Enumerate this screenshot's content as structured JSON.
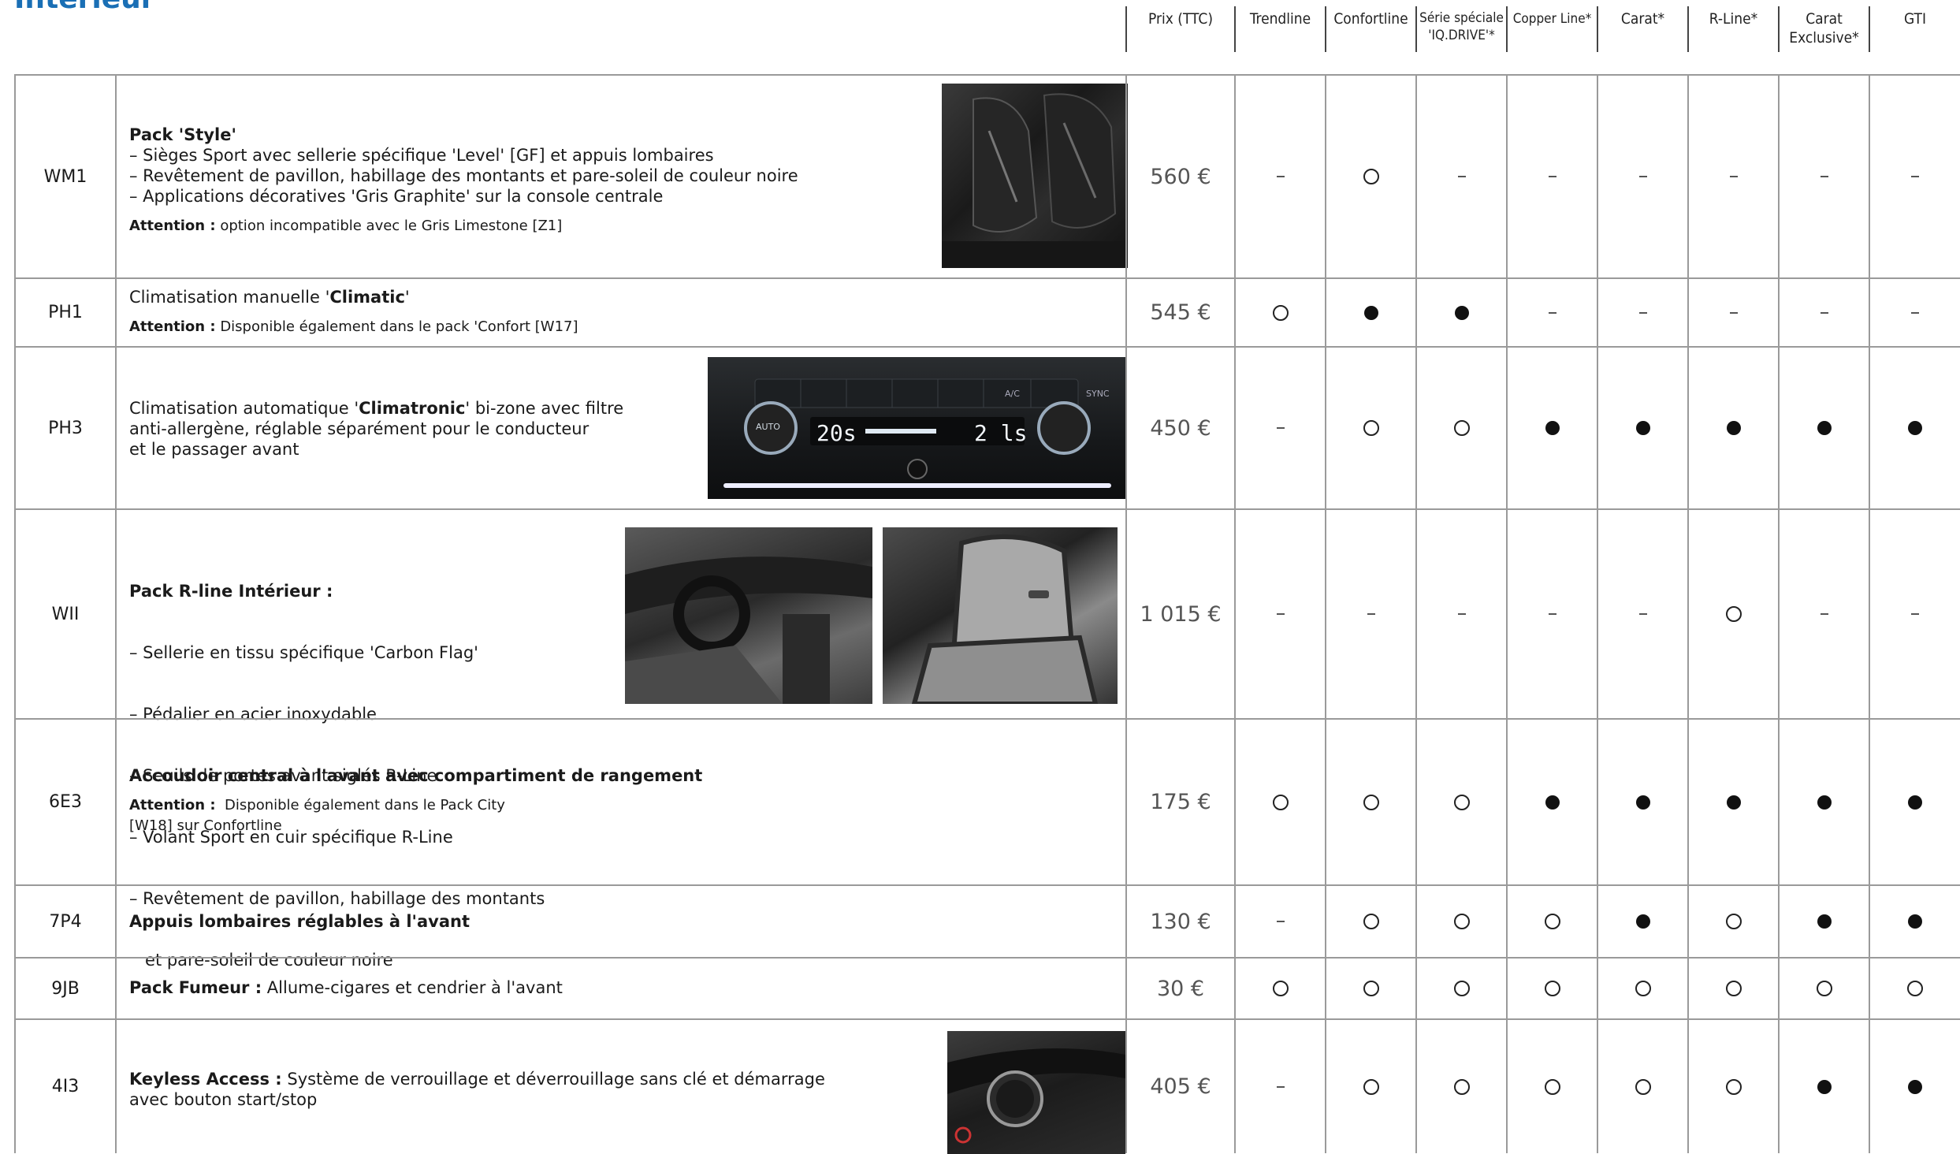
{
  "title": "Intérieur",
  "columns": [
    "Prix (TTC)",
    "Trendline",
    "Confortline",
    "Série spéciale 'IQ.DRIVE'*",
    "Copper Line*",
    "Carat*",
    "R-Line*",
    "Carat Exclusive*",
    "GTI"
  ],
  "rows": [
    {
      "code": "WM1",
      "title": "Pack 'Style'",
      "lines": [
        "– Sièges Sport avec sellerie spécifique 'Level' [GF] et appuis lombaires",
        "– Revêtement de pavillon, habillage des montants et pare-soleil de couleur noire",
        "– Applications décoratives 'Gris Graphite' sur la console centrale"
      ],
      "attention_label": "Attention :",
      "attention_text": " option incompatible avec le Gris Limestone [Z1]",
      "price": "560 €",
      "marks": [
        "dash",
        "empty",
        "dash",
        "dash",
        "dash",
        "dash",
        "dash",
        "dash"
      ]
    },
    {
      "code": "PH1",
      "text_prefix": "Climatisation manuelle '",
      "text_bold": "Climatic",
      "text_suffix": "'",
      "attention_label": "Attention :",
      "attention_text": " Disponible également dans le pack 'Confort [W17]",
      "price": "545 €",
      "marks": [
        "empty",
        "full",
        "full",
        "dash",
        "dash",
        "dash",
        "dash",
        "dash"
      ]
    },
    {
      "code": "PH3",
      "line1_prefix": "Climatisation automatique '",
      "line1_bold": "Climatronic",
      "line1_suffix": "' bi-zone avec filtre",
      "line2": "anti-allergène, réglable séparément pour le conducteur",
      "line3": "et le passager avant",
      "clim_labels": {
        "left_temp": "20s",
        "right_temp": "2 ls",
        "auto": "AUTO",
        "ac": "A/C",
        "sync": "SYNC"
      },
      "price": "450 €",
      "marks": [
        "dash",
        "empty",
        "empty",
        "full",
        "full",
        "full",
        "full",
        "full"
      ]
    },
    {
      "code": "WII",
      "title": "Pack R-line Intérieur :",
      "lines": [
        "– Sellerie en tissu spécifique 'Carbon Flag'",
        "– Pédalier en acier inoxydable",
        "– Seuils de portes avant siglés R-Line",
        "– Volant Sport en cuir spécifique R-Line",
        "– Revêtement de pavillon, habillage des montants",
        "   et pare-soleil de couleur noire"
      ],
      "price": "1 015 €",
      "marks": [
        "dash",
        "dash",
        "dash",
        "dash",
        "dash",
        "empty",
        "dash",
        "dash"
      ]
    },
    {
      "code": "6E3",
      "title": "Accoudoir central à l'avant avec compartiment de rangement",
      "attention_label": "Attention :",
      "attention_text": "  Disponible également dans le Pack City",
      "attention_text2": "[W18] sur Confortline",
      "price": "175 €",
      "marks": [
        "empty",
        "empty",
        "empty",
        "full",
        "full",
        "full",
        "full",
        "full"
      ]
    },
    {
      "code": "7P4",
      "title": "Appuis lombaires réglables à l'avant",
      "price": "130 €",
      "marks": [
        "dash",
        "empty",
        "empty",
        "empty",
        "full",
        "empty",
        "full",
        "full"
      ]
    },
    {
      "code": "9JB",
      "title": "Pack Fumeur :",
      "text": " Allume-cigares et cendrier à l'avant",
      "price": "30 €",
      "marks": [
        "empty",
        "empty",
        "empty",
        "empty",
        "empty",
        "empty",
        "empty",
        "empty"
      ]
    },
    {
      "code": "4I3",
      "title": "Keyless Access :",
      "text": " Système de verrouillage et déverrouillage sans clé et démarrage",
      "text2": "avec bouton start/stop",
      "price": "405 €",
      "marks": [
        "dash",
        "empty",
        "empty",
        "empty",
        "empty",
        "empty",
        "full",
        "full"
      ]
    }
  ]
}
